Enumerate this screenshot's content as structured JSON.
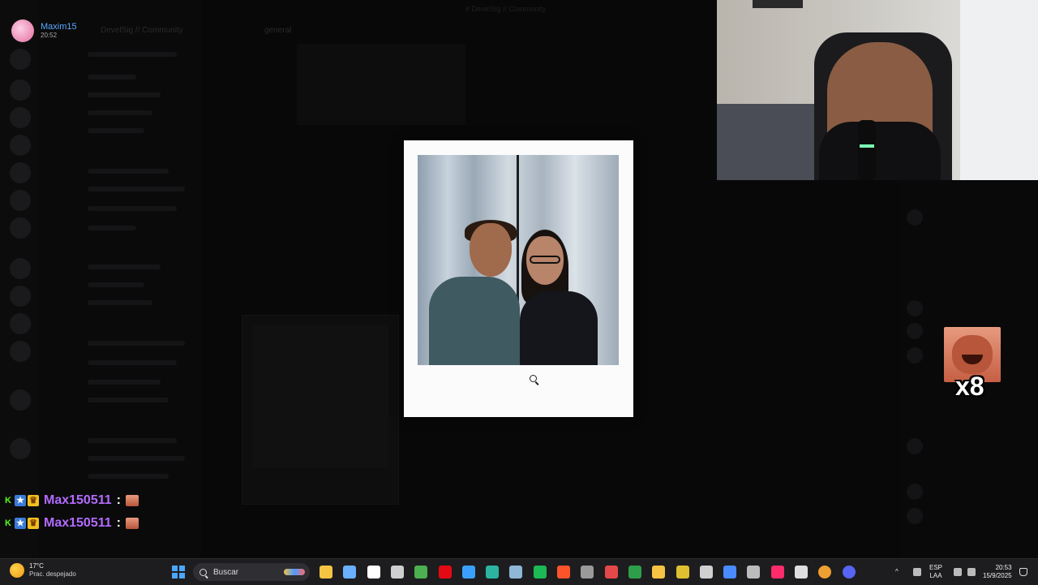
{
  "viewer": {
    "username": "Maxim15",
    "time": "20:52"
  },
  "background": {
    "server_title": "DevelSig // Community",
    "channel_title": "general",
    "top_center": "# DevelSig // Community"
  },
  "popup": {
    "kind": "polaroid image preview"
  },
  "emote_overlay": {
    "count": "x8"
  },
  "chat": {
    "messages": [
      {
        "badges": [
          "K",
          "★",
          "♛"
        ],
        "username": "Max150511",
        "separator": ":"
      },
      {
        "badges": [
          "K",
          "★",
          "♛"
        ],
        "username": "Max150511",
        "separator": ":"
      }
    ]
  },
  "taskbar": {
    "weather": {
      "temp": "17°C",
      "desc": "Prac. despejado"
    },
    "search": {
      "placeholder": "Buscar"
    },
    "language": {
      "lang": "ESP",
      "layout": "LAA"
    },
    "clock": {
      "time": "20:53",
      "date": "15/9/2025"
    },
    "apps": [
      {
        "name": "file-explorer-icon",
        "color": "#f6c443"
      },
      {
        "name": "copilot-icon",
        "color": "#6ab0ff"
      },
      {
        "name": "store-icon",
        "color": "#ffffff"
      },
      {
        "name": "settings-app-icon",
        "color": "#cfcfcf"
      },
      {
        "name": "minecraft-icon",
        "color": "#4caf50"
      },
      {
        "name": "netflix-icon",
        "color": "#e50914"
      },
      {
        "name": "battlenet-icon",
        "color": "#3aa0ff"
      },
      {
        "name": "edge-icon",
        "color": "#2bb5a0"
      },
      {
        "name": "steam-icon",
        "color": "#8fb8d8"
      },
      {
        "name": "spotify-icon",
        "color": "#1db954"
      },
      {
        "name": "brave-icon",
        "color": "#fb542b"
      },
      {
        "name": "calculator-icon",
        "color": "#9a9a9a"
      },
      {
        "name": "mystic-app-icon",
        "color": "#e54848"
      },
      {
        "name": "xbox-icon",
        "color": "#2e9e4a"
      },
      {
        "name": "folder-icon",
        "color": "#f6c443"
      },
      {
        "name": "chrome-icon",
        "color": "#e0c030"
      },
      {
        "name": "epic-games-icon",
        "color": "#d0d0d0"
      },
      {
        "name": "twitch-studio-icon",
        "color": "#4a8bff"
      },
      {
        "name": "gear-app-icon",
        "color": "#bbbbbb"
      },
      {
        "name": "tiktok-icon",
        "color": "#ff2b6b"
      },
      {
        "name": "microphone-app-icon",
        "color": "#dddddd"
      },
      {
        "name": "chrome-canary-icon",
        "color": "#f0a030"
      },
      {
        "name": "discord-icon",
        "color": "#5865f2"
      }
    ]
  }
}
